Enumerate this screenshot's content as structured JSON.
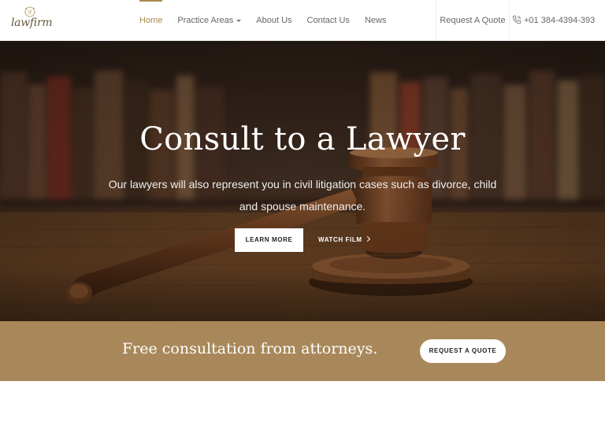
{
  "header": {
    "logo_text": "lawfirm",
    "nav": [
      {
        "label": "Home",
        "active": true
      },
      {
        "label": "Practice Areas",
        "dropdown": true
      },
      {
        "label": "About Us"
      },
      {
        "label": "Contact Us"
      },
      {
        "label": "News"
      }
    ],
    "quote_label": "Request A Quote",
    "phone": "+01 384-4394-393"
  },
  "hero": {
    "title": "Consult to a Lawyer",
    "subtitle": "Our lawyers will also represent you in civil litigation cases such as divorce, child and spouse maintenance.",
    "learn_more": "LEARN MORE",
    "watch_film": "WATCH FILM"
  },
  "cta": {
    "text": "Free consultation from attorneys.",
    "button": "REQUEST A QUOTE"
  },
  "colors": {
    "accent": "#a8894f",
    "cta_band": "#a8885a"
  },
  "icons": [
    "logo-mark-icon",
    "chevron-down-icon",
    "phone-icon",
    "chevron-right-icon"
  ]
}
